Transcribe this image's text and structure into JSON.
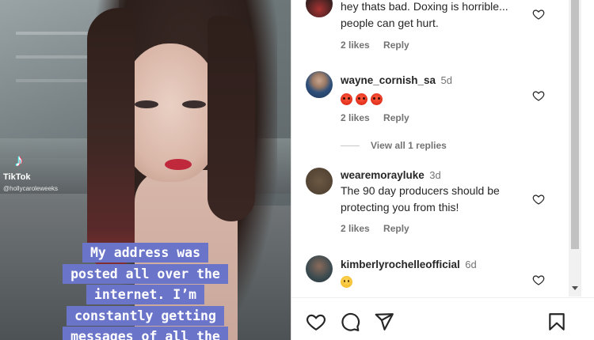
{
  "video": {
    "watermark_app": "TikTok",
    "watermark_handle": "@hollycaroleweeks",
    "caption_lines": [
      "My address was",
      "posted all over the",
      "internet. I’m",
      "constantly getting",
      "messages of all the"
    ]
  },
  "comments": [
    {
      "user": "",
      "time": "",
      "text": "hey thats bad. Doxing is horrible... people can get hurt.",
      "likes": "2 likes",
      "reply": "Reply"
    },
    {
      "user": "wayne_cornish_sa",
      "time": "5d",
      "text": "",
      "emoji": [
        "angry-face-emoji",
        "angry-face-emoji",
        "angry-face-emoji"
      ],
      "likes": "2 likes",
      "reply": "Reply"
    },
    {
      "user": "wearemorayluke",
      "time": "3d",
      "text": "The 90 day producers should be protecting you from this!",
      "likes": "2 likes",
      "reply": "Reply"
    },
    {
      "user": "kimberlyrochelleofficial",
      "time": "6d",
      "text": "",
      "emoji": [
        "sad-face-emoji"
      ],
      "likes": "",
      "reply": ""
    }
  ],
  "view_replies": "View all 1 replies",
  "actions": [
    "heart-icon",
    "comment-icon",
    "share-icon",
    "bookmark-icon"
  ],
  "colors": {
    "caption_bg": "#6a74c9",
    "text": "#262626",
    "muted": "#737373"
  }
}
